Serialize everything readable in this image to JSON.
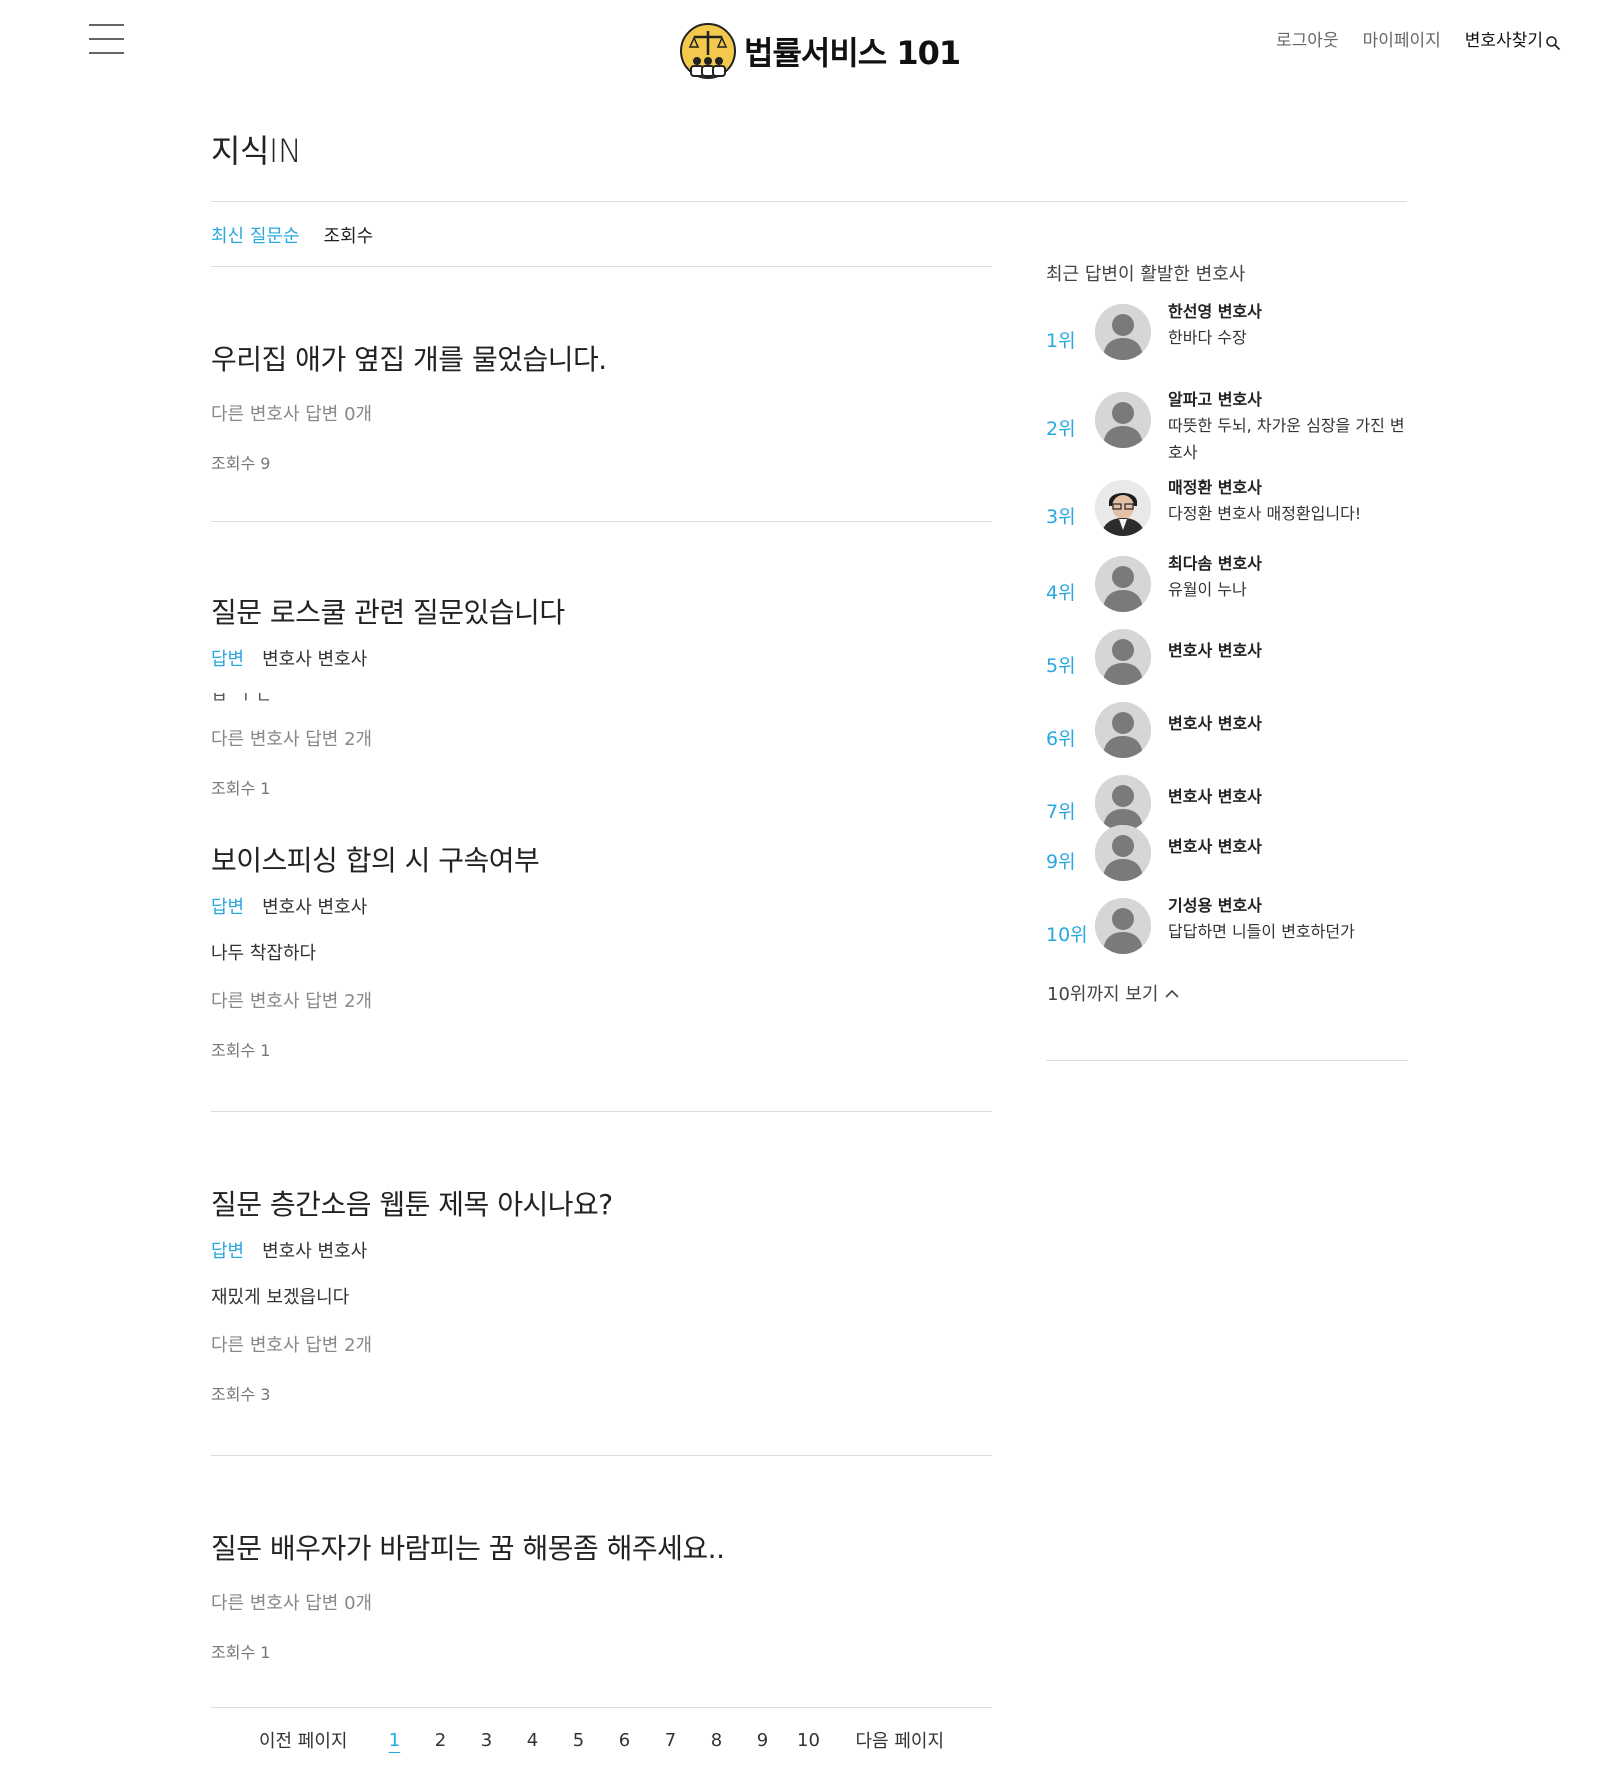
{
  "header": {
    "logo_text": "법률서비스 101",
    "nav": {
      "logout": "로그아웃",
      "mypage": "마이페이지",
      "find_lawyer": "변호사찾기"
    }
  },
  "page": {
    "title": "지식IN",
    "sort_tabs": {
      "latest": "최신 질문순",
      "views": "조회수"
    }
  },
  "questions": [
    {
      "title": "우리집 애가 옆집 개를 물었습니다.",
      "meta": "다른 변호사 답변 0개",
      "views": "조회수 9"
    },
    {
      "title": "질문 로스쿨 관련 질문있습니다",
      "answer_tag": "답변",
      "answer_author": "변호사 변호사",
      "preview": "ㅂ ㄱ ㄷ",
      "meta": "다른 변호사 답변 2개",
      "views": "조회수 1"
    },
    {
      "title": "보이스피싱 합의 시 구속여부",
      "answer_tag": "답변",
      "answer_author": "변호사 변호사",
      "preview": "나두 착잡하다",
      "meta": "다른 변호사 답변 2개",
      "views": "조회수 1"
    },
    {
      "title": "질문 층간소음 웹툰 제목 아시나요?",
      "answer_tag": "답변",
      "answer_author": "변호사 변호사",
      "preview": "재밌게 보겠읍니다",
      "meta": "다른 변호사 답변 2개",
      "views": "조회수 3"
    },
    {
      "title": "질문 배우자가 바람피는 꿈 해몽좀 해주세요..",
      "meta": "다른 변호사 답변 0개",
      "views": "조회수 1"
    }
  ],
  "pagination": {
    "prev": "이전 페이지",
    "pages": [
      "1",
      "2",
      "3",
      "4",
      "5",
      "6",
      "7",
      "8",
      "9",
      "10"
    ],
    "current": "1",
    "next": "다음 페이지"
  },
  "sidebar": {
    "heading": "최근 답변이 활발한 변호사",
    "ranks": [
      {
        "rank": "1위",
        "name": "한선영 변호사",
        "desc": "한바다 수장"
      },
      {
        "rank": "2위",
        "name": "알파고 변호사",
        "desc": "따뜻한 두뇌, 차가운 심장을 가진 변호사"
      },
      {
        "rank": "3위",
        "name": "매정환 변호사",
        "desc": "다정환 변호사 매정환입니다!"
      },
      {
        "rank": "4위",
        "name": "최다솜 변호사",
        "desc": "유월이 누나"
      },
      {
        "rank": "5위",
        "name": "변호사 변호사",
        "desc": ""
      },
      {
        "rank": "6위",
        "name": "변호사 변호사",
        "desc": ""
      },
      {
        "rank": "7위",
        "name": "변호사 변호사",
        "desc": ""
      },
      {
        "rank": "9위",
        "name": "변호사 변호사",
        "desc": ""
      },
      {
        "rank": "10위",
        "name": "기성용 변호사",
        "desc": "답답하면 니들이 변호하던가"
      }
    ],
    "more_label": "10위까지 보기"
  },
  "colors": {
    "accent": "#29a8e0",
    "text": "#222222",
    "muted": "#888888",
    "rule": "#dcdcdc"
  },
  "icons": {
    "menu": "hamburger-icon",
    "search": "search-icon",
    "more": "chevron-up-icon",
    "avatar": "default-person-avatar"
  }
}
